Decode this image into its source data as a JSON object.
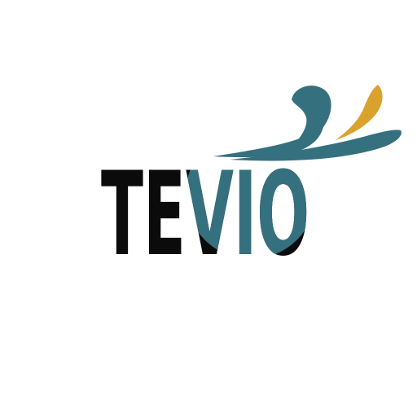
{
  "logo": {
    "wordmark": "TEVIO",
    "colors": {
      "teal": "#35707f",
      "gold": "#d9a22c",
      "text": "#0b0b0b",
      "background": "#ffffff"
    },
    "icon": "stylized-swoosh-figure-icon"
  }
}
